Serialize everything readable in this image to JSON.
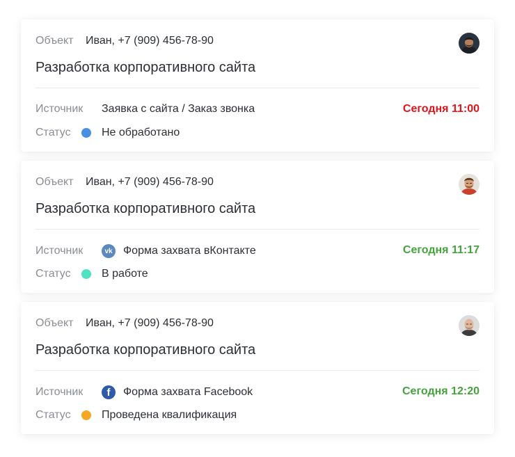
{
  "colors": {
    "time_red": "#e0141b",
    "time_green": "#45a33c",
    "status_new": "#4a90e2",
    "status_in_work": "#50e3c2",
    "status_qualified": "#f5a623"
  },
  "cards": [
    {
      "object_label": "Объект",
      "object_value": "Иван, +7 (909) 456-78-90",
      "title": "Разработка корпоративного сайта",
      "source_label": "Источник",
      "source_value": "Заявка с сайта / Заказ звонка",
      "source_icon": "",
      "time": "Сегодня 11:00",
      "time_color": "#e0141b",
      "status_label": "Статус",
      "status_value": "Не обработано",
      "status_color": "#4a90e2",
      "avatar": "man-dark-avatar"
    },
    {
      "object_label": "Объект",
      "object_value": "Иван, +7 (909) 456-78-90",
      "title": "Разработка корпоративного сайта",
      "source_label": "Источник",
      "source_value": "Форма захвата вКонтакте",
      "source_icon": "vk-icon",
      "time": "Сегодня 11:17",
      "time_color": "#45a33c",
      "status_label": "Статус",
      "status_value": "В работе",
      "status_color": "#50e3c2",
      "avatar": "man-beard-avatar"
    },
    {
      "object_label": "Объект",
      "object_value": "Иван, +7 (909) 456-78-90",
      "title": "Разработка корпоративного сайта",
      "source_label": "Источник",
      "source_value": "Форма захвата Facebook",
      "source_icon": "facebook-icon",
      "time": "Сегодня 12:20",
      "time_color": "#45a33c",
      "status_label": "Статус",
      "status_value": "Проведена квалификация",
      "status_color": "#f5a623",
      "avatar": "man-bald-avatar"
    }
  ]
}
